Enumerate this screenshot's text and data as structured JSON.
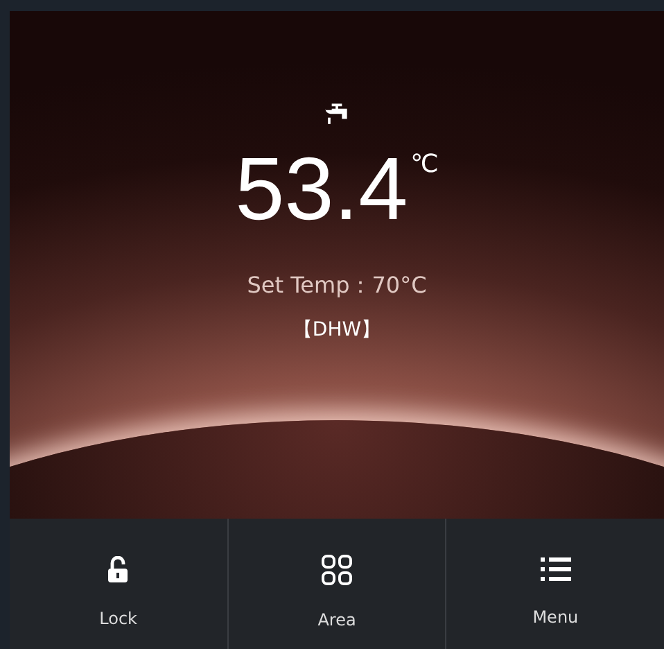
{
  "display": {
    "temperature": "53.4",
    "unit": "℃",
    "set_temp": "Set Temp：70°C",
    "mode": "【DHW】"
  },
  "buttons": [
    {
      "label": "Lock",
      "kind": "lock"
    },
    {
      "label": "Area",
      "kind": "grid"
    },
    {
      "label": "Menu",
      "kind": "list"
    }
  ]
}
